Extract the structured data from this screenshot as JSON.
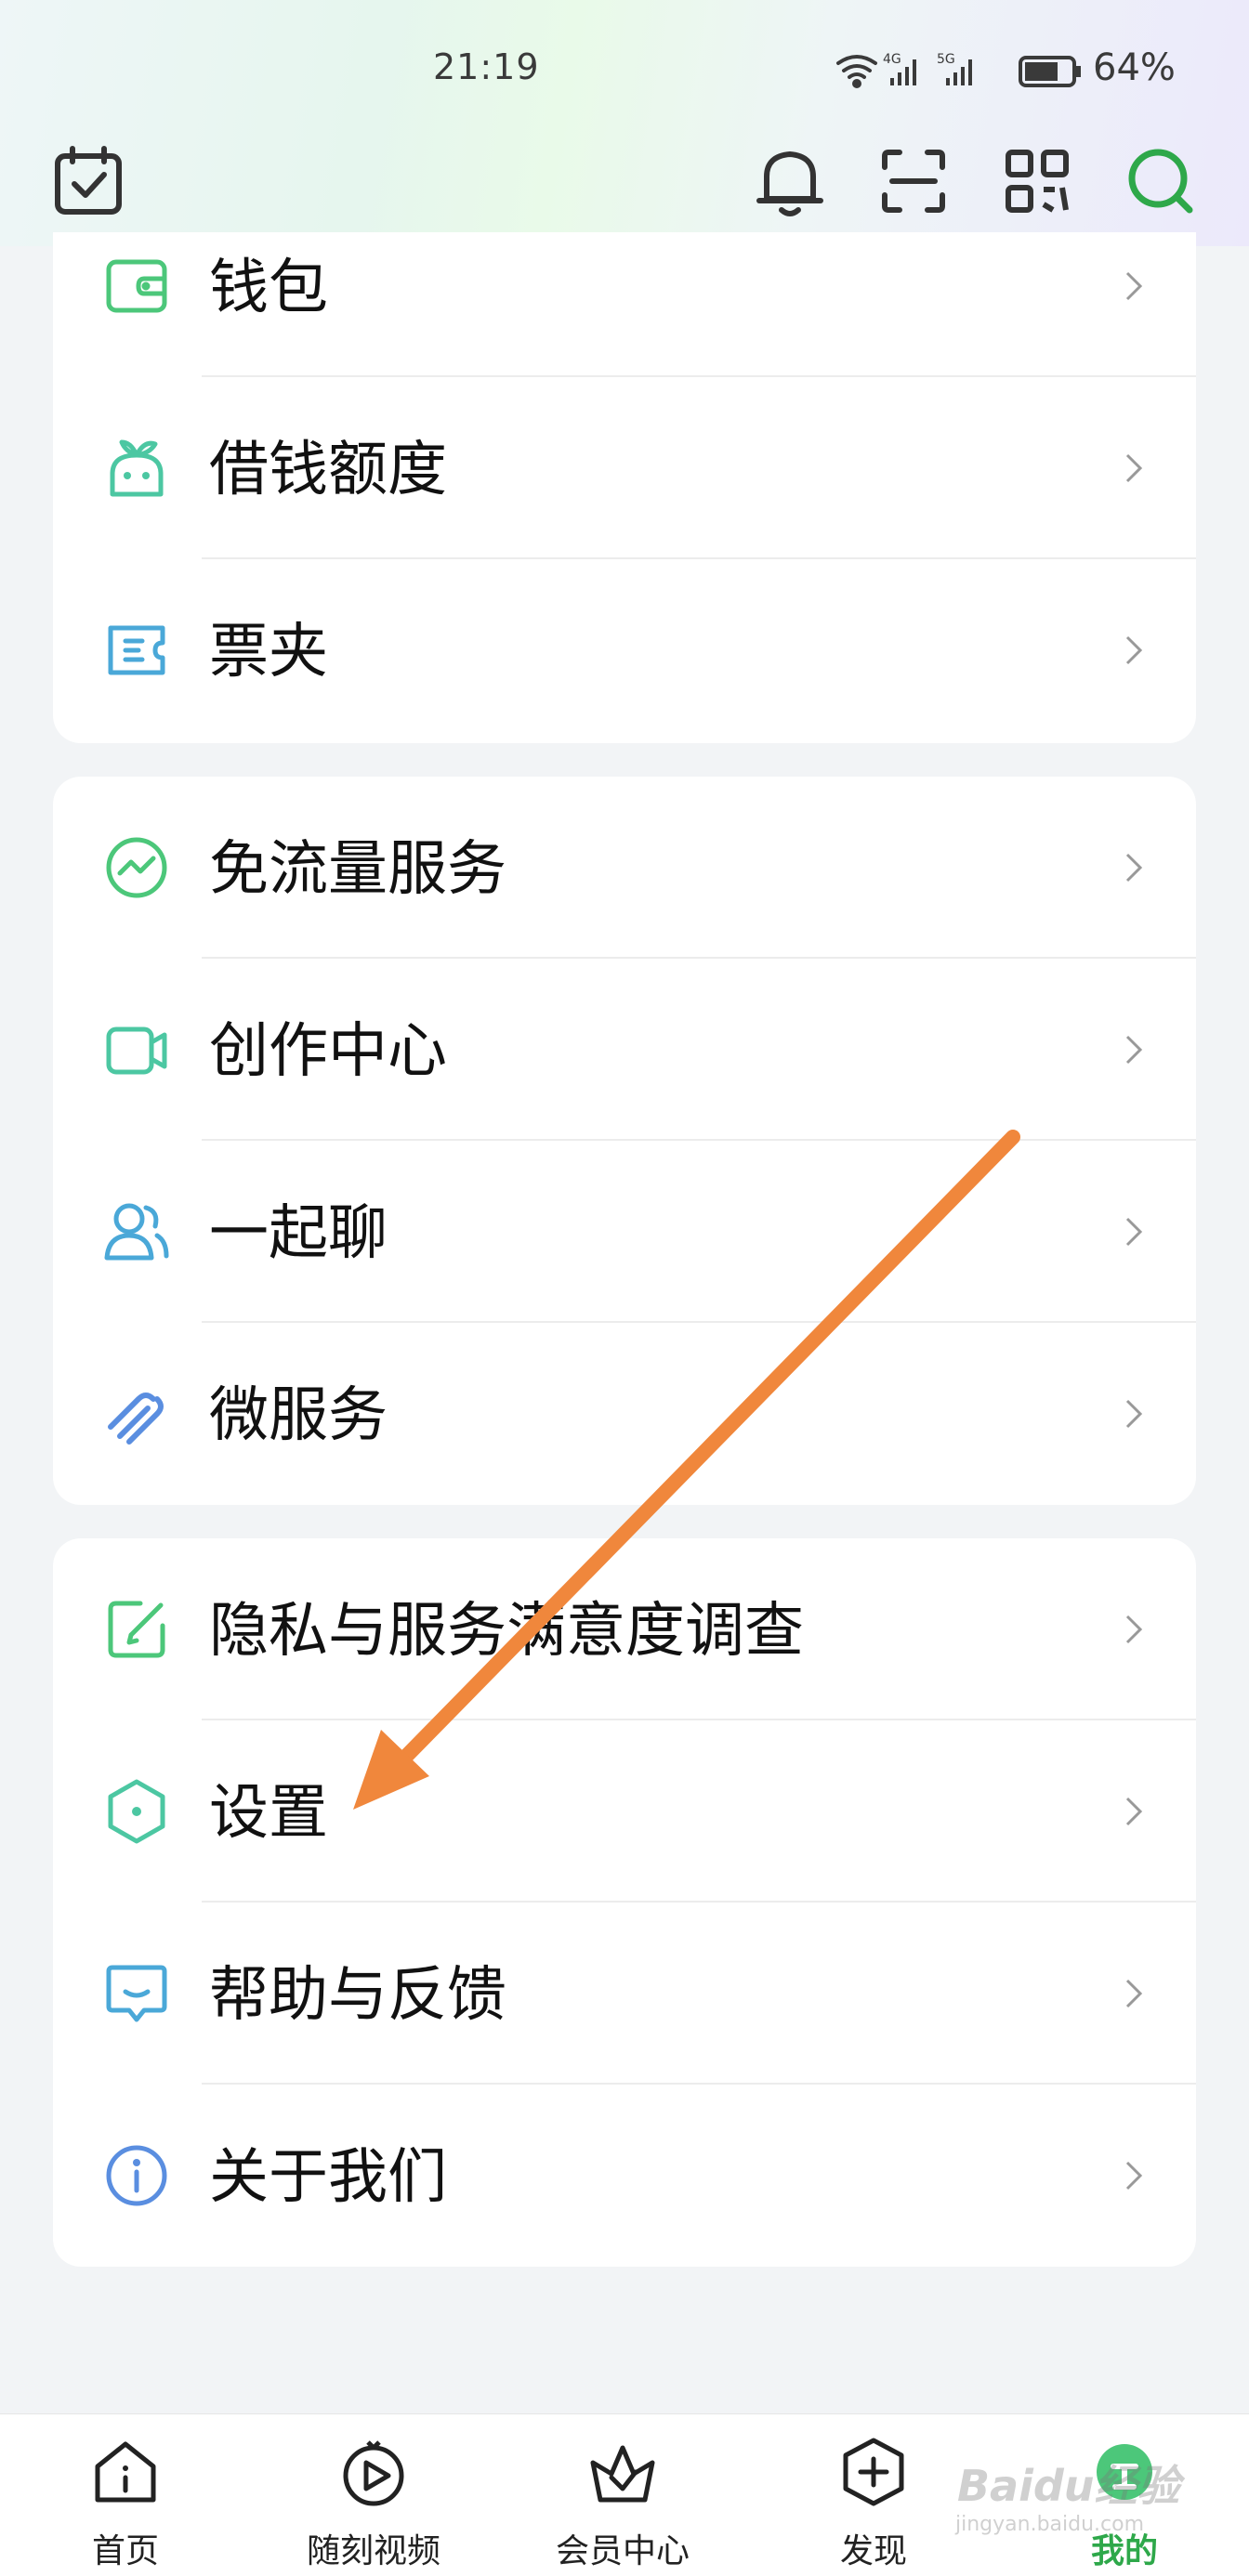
{
  "status_bar": {
    "time": "21:19",
    "battery": "64%",
    "network_a": "4G",
    "network_b": "5G"
  },
  "top_nav": {
    "icons": [
      "calendar-check-icon",
      "bell-icon",
      "scan-icon",
      "qr-code-icon",
      "search-icon"
    ]
  },
  "cards": [
    {
      "items": [
        {
          "label": "钱包",
          "icon": "wallet-icon"
        },
        {
          "label": "借钱额度",
          "icon": "sprout-face-icon"
        },
        {
          "label": "票夹",
          "icon": "ticket-folder-icon"
        }
      ]
    },
    {
      "items": [
        {
          "label": "免流量服务",
          "icon": "data-free-icon"
        },
        {
          "label": "创作中心",
          "icon": "video-camera-icon"
        },
        {
          "label": "一起聊",
          "icon": "people-icon"
        },
        {
          "label": "微服务",
          "icon": "link-icon"
        }
      ]
    },
    {
      "items": [
        {
          "label": "隐私与服务满意度调查",
          "icon": "edit-square-icon"
        },
        {
          "label": "设置",
          "icon": "hexagon-settings-icon"
        },
        {
          "label": "帮助与反馈",
          "icon": "chat-feedback-icon"
        },
        {
          "label": "关于我们",
          "icon": "info-icon"
        }
      ]
    }
  ],
  "bottom_tabs": [
    {
      "label": "首页",
      "icon": "home-icon"
    },
    {
      "label": "随刻视频",
      "icon": "play-icon"
    },
    {
      "label": "会员中心",
      "icon": "vip-basket-icon"
    },
    {
      "label": "发现",
      "icon": "discover-plus-icon"
    },
    {
      "label": "我的",
      "icon": "profile-icon",
      "active": true
    }
  ],
  "colors": {
    "accent_green": "#2ea84a",
    "arrow_orange": "#f0873c",
    "icon_green": "#4cc77a",
    "icon_blue": "#4aa8d8"
  },
  "watermark": {
    "brand": "Baidu经验",
    "url": "jingyan.baidu.com"
  }
}
